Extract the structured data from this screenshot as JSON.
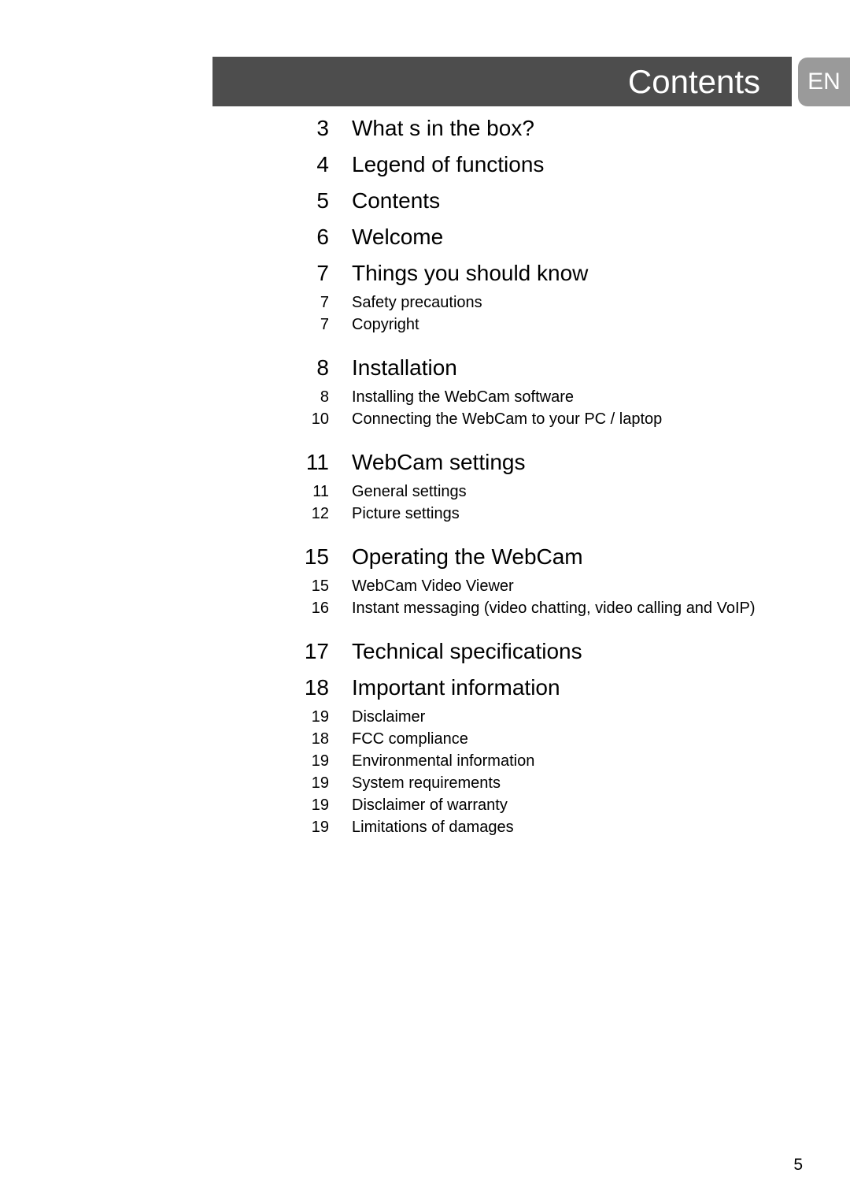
{
  "header": {
    "title": "Contents",
    "language_tab": "EN"
  },
  "toc": {
    "entries": [
      {
        "level": 1,
        "page": "3",
        "label": "What s in the box?",
        "gap_before": false
      },
      {
        "level": 1,
        "page": "4",
        "label": "Legend of functions",
        "gap_before": false
      },
      {
        "level": 1,
        "page": "5",
        "label": "Contents",
        "gap_before": false
      },
      {
        "level": 1,
        "page": "6",
        "label": "Welcome",
        "gap_before": false
      },
      {
        "level": 1,
        "page": "7",
        "label": "Things you should know",
        "gap_before": false
      },
      {
        "level": 2,
        "page": "7",
        "label": "Safety precautions",
        "gap_before": false
      },
      {
        "level": 2,
        "page": "7",
        "label": "Copyright",
        "gap_before": false
      },
      {
        "level": 1,
        "page": "8",
        "label": "Installation",
        "gap_before": true
      },
      {
        "level": 2,
        "page": "8",
        "label": "Installing the WebCam software",
        "gap_before": false
      },
      {
        "level": 2,
        "page": "10",
        "label": "Connecting the WebCam to your PC / laptop",
        "gap_before": false
      },
      {
        "level": 1,
        "page": "11",
        "label": "WebCam settings",
        "gap_before": true
      },
      {
        "level": 2,
        "page": "11",
        "label": "General settings",
        "gap_before": false
      },
      {
        "level": 2,
        "page": "12",
        "label": "Picture settings",
        "gap_before": false
      },
      {
        "level": 1,
        "page": "15",
        "label": "Operating the WebCam",
        "gap_before": true
      },
      {
        "level": 2,
        "page": "15",
        "label": "WebCam Video Viewer",
        "gap_before": false
      },
      {
        "level": 2,
        "page": "16",
        "label": "Instant messaging (video chatting, video calling and VoIP)",
        "gap_before": false
      },
      {
        "level": 1,
        "page": "17",
        "label": "Technical specifications",
        "gap_before": true
      },
      {
        "level": 1,
        "page": "18",
        "label": "Important information",
        "gap_before": false
      },
      {
        "level": 2,
        "page": "19",
        "label": "Disclaimer",
        "gap_before": false
      },
      {
        "level": 2,
        "page": "18",
        "label": "FCC compliance",
        "gap_before": false
      },
      {
        "level": 2,
        "page": "19",
        "label": "Environmental information",
        "gap_before": false
      },
      {
        "level": 2,
        "page": "19",
        "label": "System requirements",
        "gap_before": false
      },
      {
        "level": 2,
        "page": "19",
        "label": "Disclaimer of warranty",
        "gap_before": false
      },
      {
        "level": 2,
        "page": "19",
        "label": "Limitations of damages",
        "gap_before": false
      }
    ]
  },
  "footer": {
    "page_number": "5"
  },
  "colors": {
    "header_bar": "#4d4d4d",
    "language_tab": "#9a9a9a",
    "text": "#000000",
    "background": "#ffffff"
  }
}
